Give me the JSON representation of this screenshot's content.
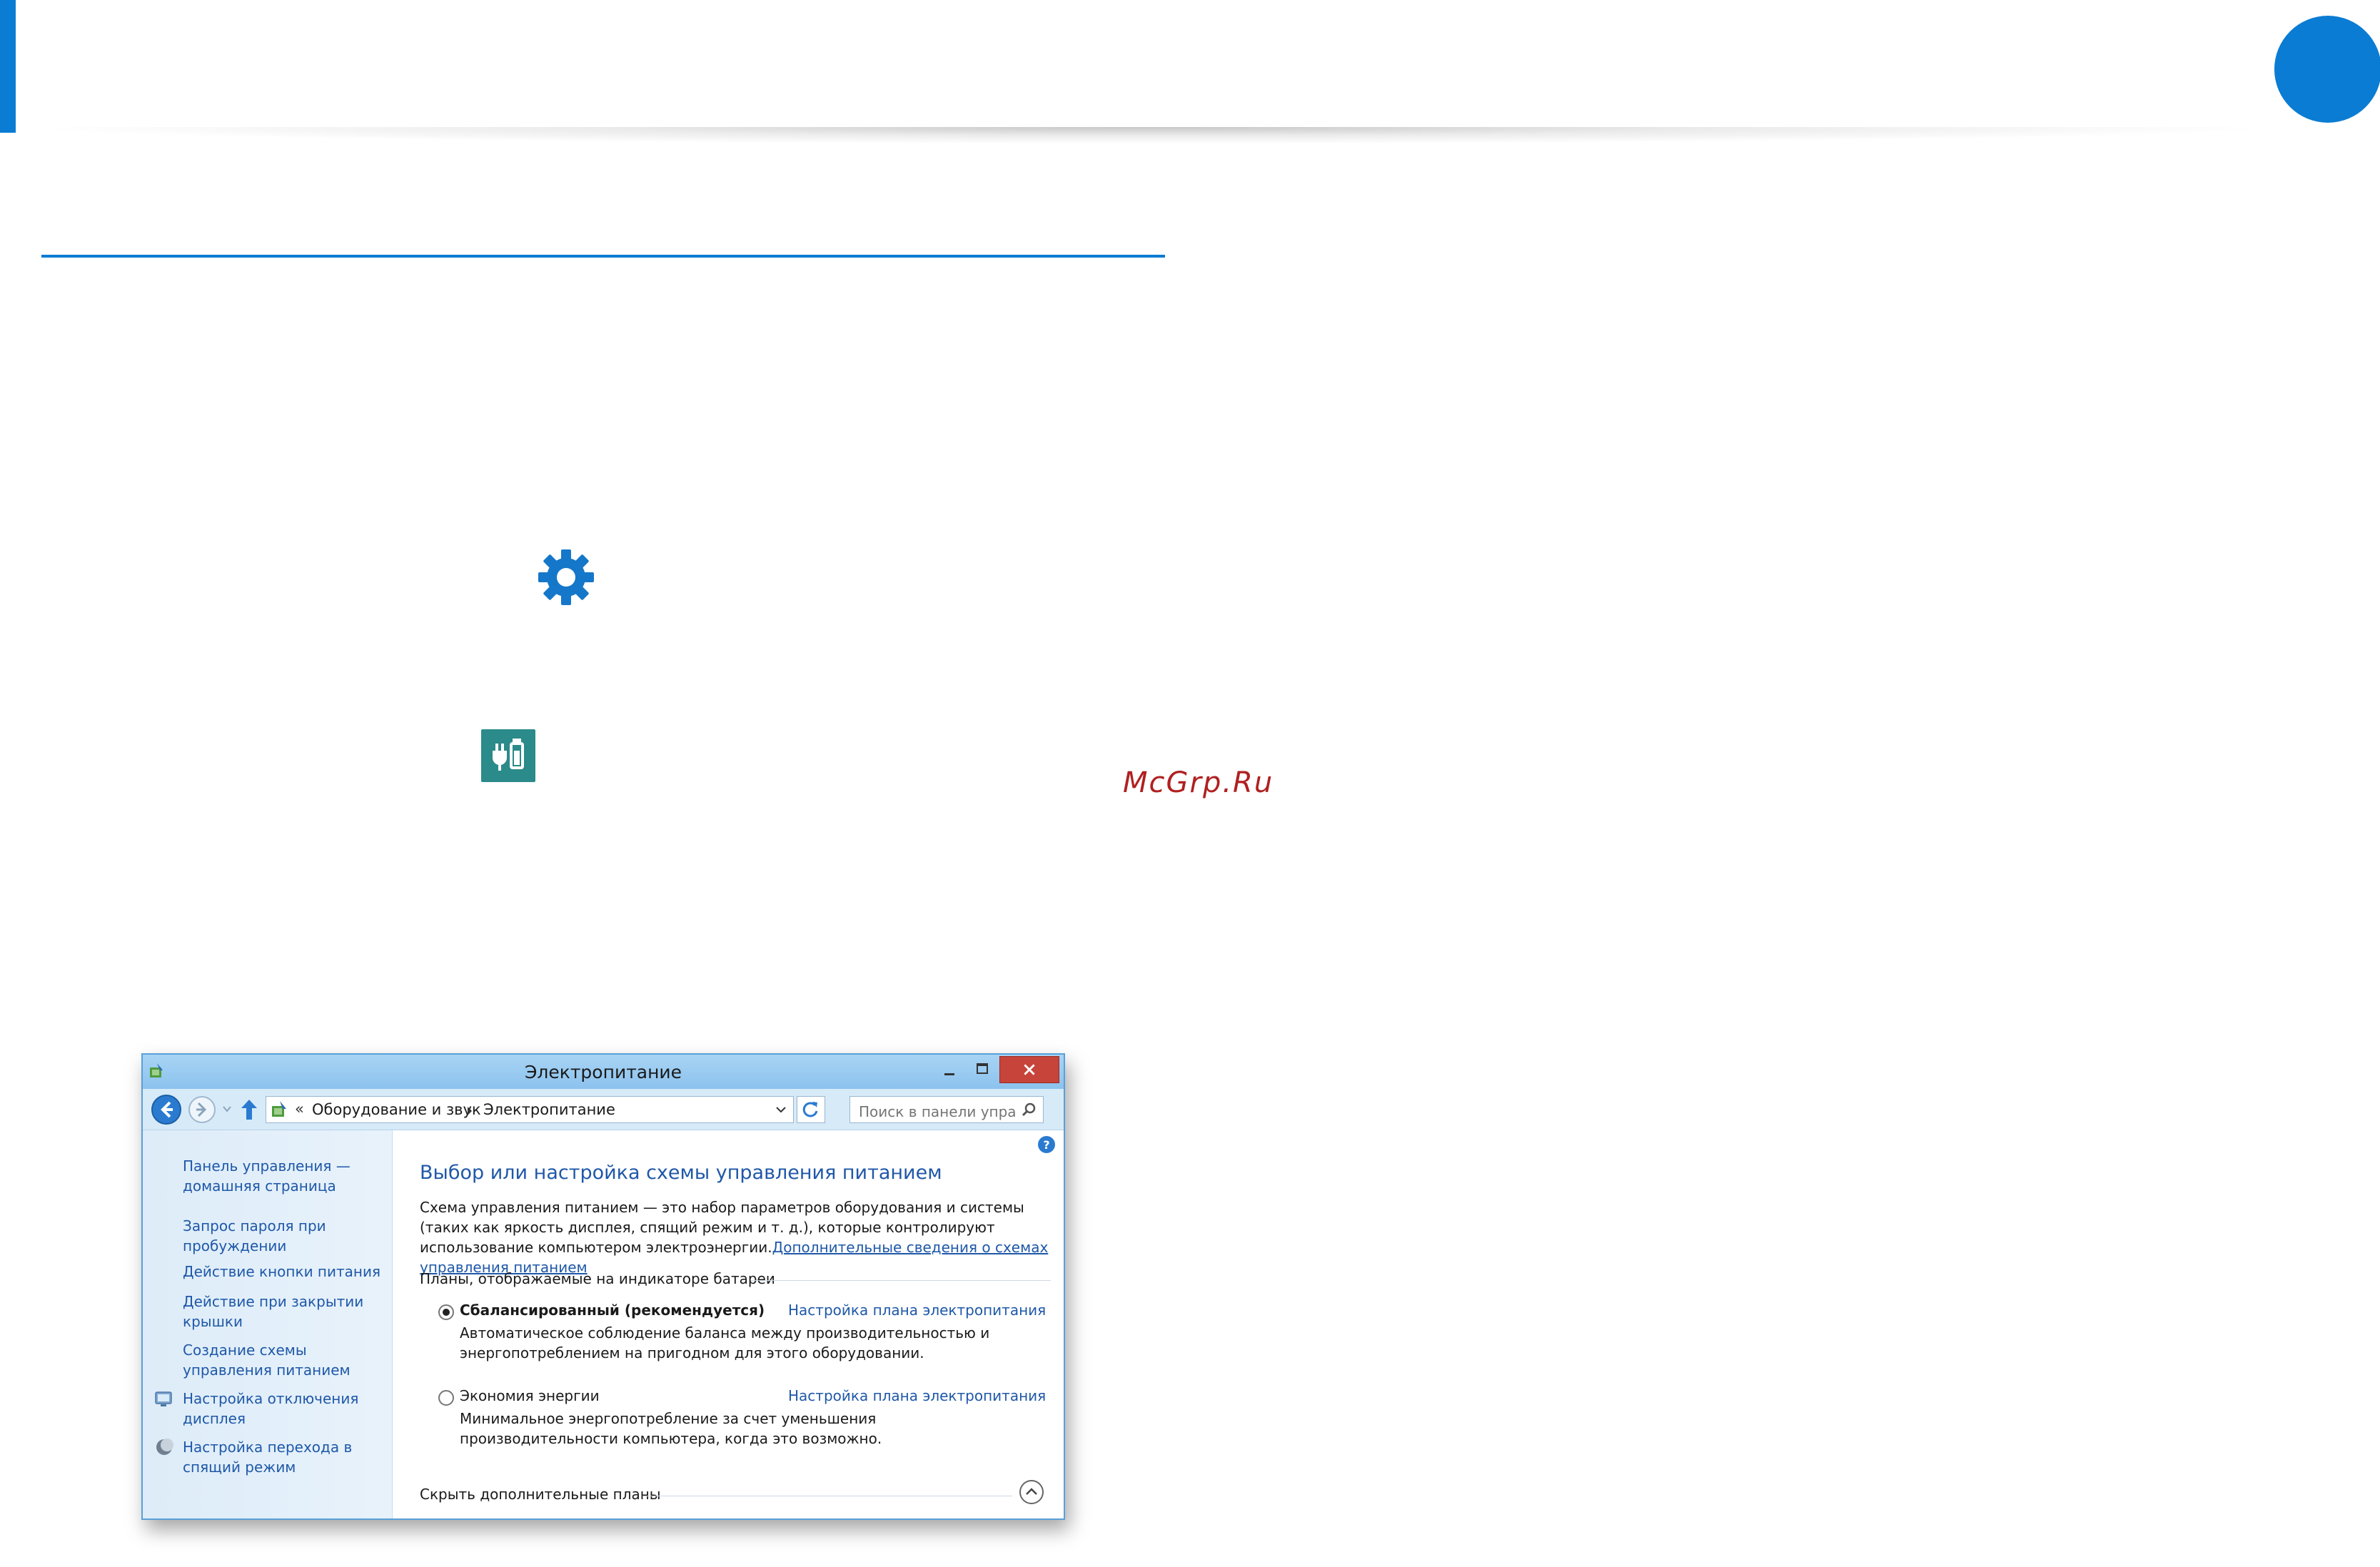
{
  "watermark": "McGrp.Ru",
  "window": {
    "title": "Электропитание"
  },
  "address_bar": {
    "chevrons": "«",
    "segment_1": "Оборудование и звук",
    "segment_2": "Электропитание"
  },
  "search": {
    "placeholder": "Поиск в панели упра..."
  },
  "sidebar": {
    "home": "Панель управления — домашняя страница",
    "items": [
      "Запрос пароля при пробуждении",
      "Действие кнопки питания",
      "Действие при закрытии крышки",
      "Создание схемы управления питанием",
      "Настройка отключения дисплея",
      "Настройка перехода в спящий режим"
    ]
  },
  "main": {
    "title": "Выбор или настройка схемы управления питанием",
    "description": "Схема управления питанием — это набор параметров оборудования и системы (таких как яркость дисплея, спящий режим и т. д.), которые контролируют использование компьютером электроэнергии.",
    "description_link": "Дополнительные сведения о схемах управления питанием",
    "group_label": "Планы, отображаемые на индикаторе батареи",
    "plans": [
      {
        "name": "Сбалансированный (рекомендуется)",
        "link": "Настройка плана электропитания",
        "description": "Автоматическое соблюдение баланса между производительностью и энергопотреблением на пригодном для этого оборудовании.",
        "selected": true
      },
      {
        "name": "Экономия энергии",
        "link": "Настройка плана электропитания",
        "description": "Минимальное энергопотребление за счет уменьшения производительности компьютера, когда это возможно.",
        "selected": false
      }
    ],
    "hide_plans": "Скрыть дополнительные планы"
  },
  "icons": {
    "settings": "gear-icon",
    "power_tile": "power-plug-battery-icon",
    "accent_color": "#0a7cd3",
    "tile_color": "#2b8a8a"
  }
}
